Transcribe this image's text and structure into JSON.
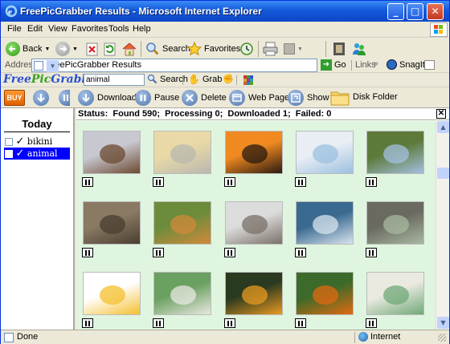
{
  "window": {
    "title": "FreePicGrabber Results - Microsoft Internet Explorer"
  },
  "menu": [
    "File",
    "Edit",
    "View",
    "Favorites",
    "Tools",
    "Help"
  ],
  "toolbar": {
    "back": "Back",
    "search": "Search",
    "favorites": "Favorites"
  },
  "address": {
    "label": "Address",
    "value": "FreePicGrabber Results",
    "go": "Go",
    "links": "Links",
    "snagit": "SnagIt"
  },
  "fpg_bar": {
    "logo_free": "Free",
    "logo_pic": "Pic",
    "logo_grabber": "Grabber",
    "search_value": "animal",
    "search": "Search",
    "grab": "Grab"
  },
  "actions": {
    "buy": "BUY",
    "download": "Download",
    "pause": "Pause",
    "delete": "Delete",
    "web_page": "Web Page",
    "show": "Show",
    "disk_folder": "Disk Folder"
  },
  "sidebar": {
    "heading": "Today",
    "items": [
      {
        "label": "bikini",
        "selected": false
      },
      {
        "label": "animal",
        "selected": true
      }
    ]
  },
  "status": {
    "text": "Status:  Found 590;  Processing 0;  Downloaded 1;  Failed: 0"
  },
  "thumbnails": [
    {
      "subject": "horses-in-snow",
      "color": "#c8c8d0",
      "accent": "#6b4a30"
    },
    {
      "subject": "kitten-and-ducklings",
      "color": "#e8d9a6",
      "accent": "#b8b8b0"
    },
    {
      "subject": "sunset-palm",
      "color": "#f08a20",
      "accent": "#2a1a10"
    },
    {
      "subject": "polar-bear",
      "color": "#e8eef4",
      "accent": "#9cc0e0"
    },
    {
      "subject": "mountain-lake",
      "color": "#5d7a3a",
      "accent": "#a4c0e0"
    },
    {
      "subject": "tabby-kitten",
      "color": "#8a7a64",
      "accent": "#4a3e30"
    },
    {
      "subject": "tiger-cubs",
      "color": "#6c8c3c",
      "accent": "#d08a3a"
    },
    {
      "subject": "wolf-in-snow",
      "color": "#dcdcdc",
      "accent": "#7a7068"
    },
    {
      "subject": "mountain-river",
      "color": "#3a6a90",
      "accent": "#d8e4ee"
    },
    {
      "subject": "zoo-enclosure",
      "color": "#6a6a60",
      "accent": "#a8b8a0"
    },
    {
      "subject": "cartoon-bunny-lion",
      "color": "#ffffff",
      "accent": "#f4c030"
    },
    {
      "subject": "zoo-map",
      "color": "#6aa060",
      "accent": "#e8e8e0"
    },
    {
      "subject": "tiger-butterfly",
      "color": "#2a3a20",
      "accent": "#e89a20"
    },
    {
      "subject": "monarch-butterfly",
      "color": "#3c6a2a",
      "accent": "#e06a10"
    },
    {
      "subject": "park-map",
      "color": "#eaeae0",
      "accent": "#70a878"
    }
  ],
  "statusbar": {
    "done": "Done",
    "zone": "Internet"
  },
  "colors": {
    "title_bar": "#0c47c8",
    "grid_bg": "#dff5df",
    "selection": "#0000ff"
  }
}
